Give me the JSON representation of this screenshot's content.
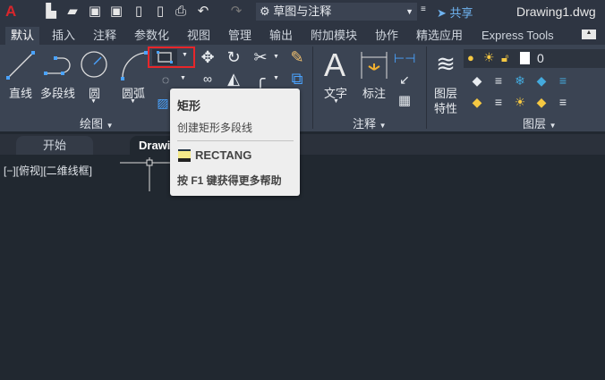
{
  "titlebar": {
    "app_logo": "A",
    "workspace": "草图与注释",
    "share": "共享",
    "document": "Drawing1.dwg"
  },
  "ribbon_tabs": [
    "默认",
    "插入",
    "注释",
    "参数化",
    "视图",
    "管理",
    "输出",
    "附加模块",
    "协作",
    "精选应用",
    "Express Tools"
  ],
  "draw_panel": {
    "line": "直线",
    "polyline": "多段线",
    "circle": "圆",
    "arc": "圆弧",
    "label": "绘图"
  },
  "annotation_panel": {
    "text": "文字",
    "dimension": "标注",
    "label": "注释"
  },
  "layers_panel": {
    "properties_line1": "图层",
    "properties_line2": "特性",
    "layer_name": "0",
    "label": "图层"
  },
  "doc_tabs": [
    "开始",
    "Drawing1"
  ],
  "viewport_label": "[−][俯视][二维线框]",
  "tooltip": {
    "title": "矩形",
    "description": "创建矩形多段线",
    "command": "RECTANG",
    "help": "按 F1 键获得更多帮助"
  },
  "colors": {
    "highlight": "#e8262a",
    "accent": "#4aa3ff"
  }
}
